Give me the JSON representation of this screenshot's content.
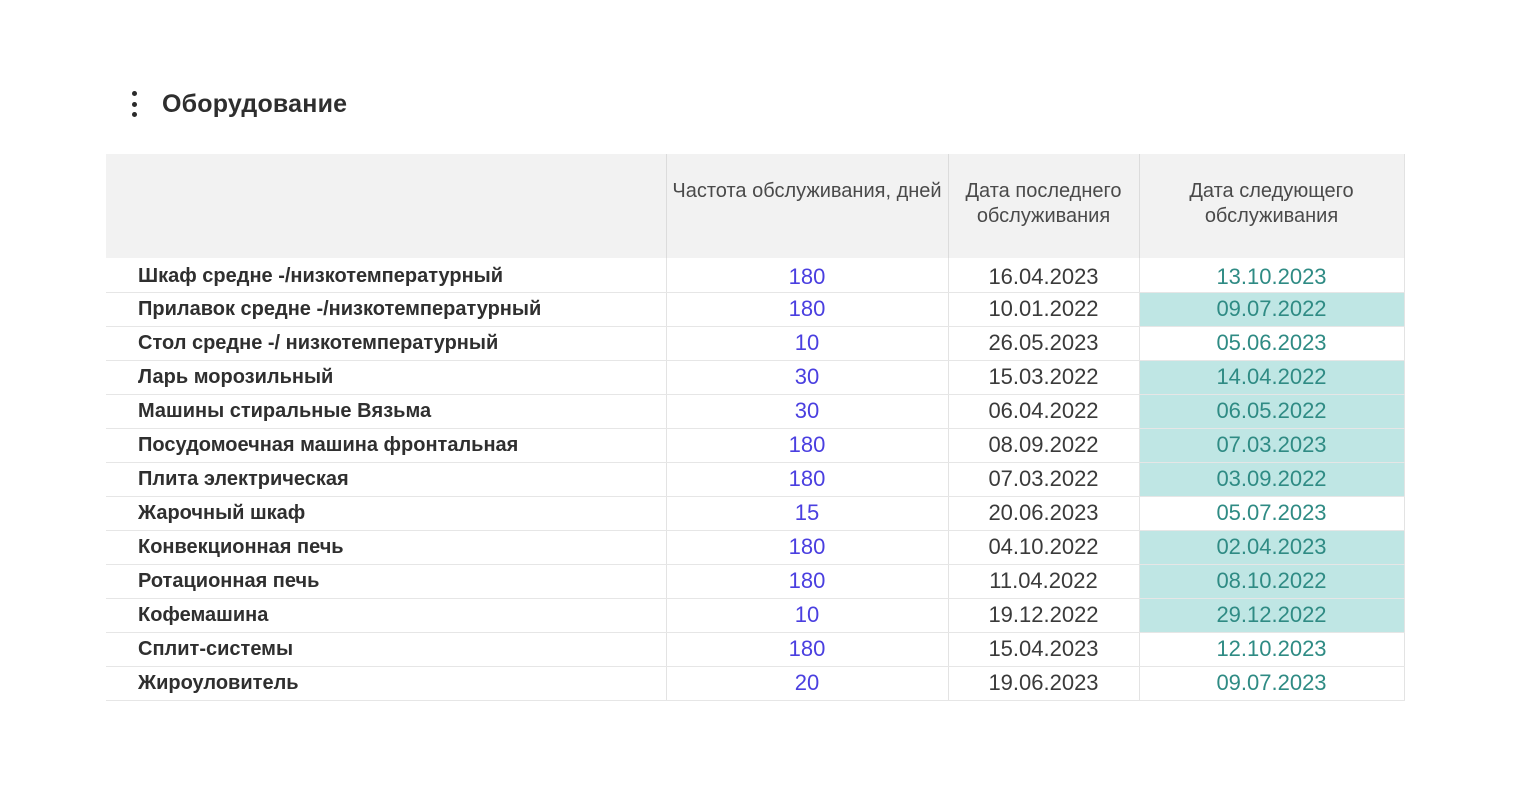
{
  "section": {
    "title": "Оборудование",
    "menu_icon": "kebab-vertical-icon"
  },
  "colors": {
    "frequency_text": "#4a3fe0",
    "next_date_text": "#2f8b84",
    "overdue_highlight": "#bfe6e4",
    "header_background": "#f2f2f2"
  },
  "table": {
    "headers": {
      "name": "",
      "frequency": "Частота обслуживания, дней",
      "last": "Дата последнего обслуживания",
      "next": "Дата следующего обслуживания"
    },
    "rows": [
      {
        "name": "Шкаф средне -/низкотемпературный",
        "frequency": "180",
        "last": "16.04.2023",
        "next": "13.10.2023",
        "highlighted": false
      },
      {
        "name": "Прилавок средне -/низкотемпературный",
        "frequency": "180",
        "last": "10.01.2022",
        "next": "09.07.2022",
        "highlighted": true
      },
      {
        "name": "Стол средне -/ низкотемпературный",
        "frequency": "10",
        "last": "26.05.2023",
        "next": "05.06.2023",
        "highlighted": false
      },
      {
        "name": "Ларь морозильный",
        "frequency": "30",
        "last": "15.03.2022",
        "next": "14.04.2022",
        "highlighted": true
      },
      {
        "name": "Машины стиральные Вязьма",
        "frequency": "30",
        "last": "06.04.2022",
        "next": "06.05.2022",
        "highlighted": true
      },
      {
        "name": "Посудомоечная машина  фронтальная",
        "frequency": "180",
        "last": "08.09.2022",
        "next": "07.03.2023",
        "highlighted": true
      },
      {
        "name": "Плита электрическая",
        "frequency": "180",
        "last": "07.03.2022",
        "next": "03.09.2022",
        "highlighted": true
      },
      {
        "name": "Жарочный шкаф",
        "frequency": "15",
        "last": "20.06.2023",
        "next": "05.07.2023",
        "highlighted": false
      },
      {
        "name": "Конвекционная печь",
        "frequency": "180",
        "last": "04.10.2022",
        "next": "02.04.2023",
        "highlighted": true
      },
      {
        "name": "Ротационная печь",
        "frequency": "180",
        "last": "11.04.2022",
        "next": "08.10.2022",
        "highlighted": true
      },
      {
        "name": "Кофемашина",
        "frequency": "10",
        "last": "19.12.2022",
        "next": "29.12.2022",
        "highlighted": true
      },
      {
        "name": "Сплит-системы",
        "frequency": "180",
        "last": "15.04.2023",
        "next": "12.10.2023",
        "highlighted": false
      },
      {
        "name": "Жироуловитель",
        "frequency": "20",
        "last": "19.06.2023",
        "next": "09.07.2023",
        "highlighted": false
      }
    ]
  }
}
